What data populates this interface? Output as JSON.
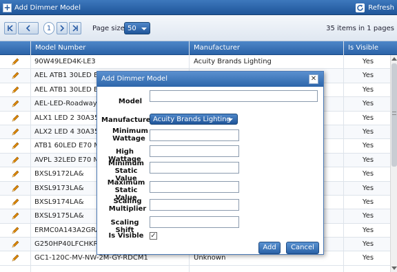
{
  "toolbar": {
    "add_label": "Add Dimmer Model",
    "refresh_label": "Refresh"
  },
  "pager": {
    "current_page": "1",
    "page_size_label": "Page size:",
    "page_size_value": "50",
    "items_info": "35 items in 1 pages"
  },
  "grid": {
    "columns": [
      "Model Number",
      "Manufacturer",
      "Is Visible"
    ],
    "rows": [
      {
        "model": "90W49LED4K-LE3",
        "manufacturer": "Acuity Brands Lighting",
        "visible": "Yes"
      },
      {
        "model": "AEL ATB1 30LED E53",
        "manufacturer": "",
        "visible": "Yes"
      },
      {
        "model": "AEL ATB1 30LED E70",
        "manufacturer": "",
        "visible": "Yes"
      },
      {
        "model": "AEL-LED-Roadway",
        "manufacturer": "",
        "visible": "Yes"
      },
      {
        "model": "ALX1 LED 2 30A350/",
        "manufacturer": "",
        "visible": "Yes"
      },
      {
        "model": "ALX2 LED 4 30A350/",
        "manufacturer": "",
        "visible": "Yes"
      },
      {
        "model": "ATB1 60LED E70 MVO",
        "manufacturer": "",
        "visible": "Yes"
      },
      {
        "model": "AVPL 32LED E70 MVO",
        "manufacturer": "",
        "visible": "Yes"
      },
      {
        "model": "BXSL9172LA&",
        "manufacturer": "",
        "visible": "Yes"
      },
      {
        "model": "BXSL9173LA&",
        "manufacturer": "",
        "visible": "Yes"
      },
      {
        "model": "BXSL9174LA&",
        "manufacturer": "",
        "visible": "Yes"
      },
      {
        "model": "BXSL9175LA&",
        "manufacturer": "",
        "visible": "Yes"
      },
      {
        "model": "ERMC0A143A2GRAY",
        "manufacturer": "",
        "visible": "Yes"
      },
      {
        "model": "G250HP40LFCHKR-D",
        "manufacturer": "",
        "visible": "Yes"
      },
      {
        "model": "GC1-120C-MV-NW-2M-GY-RDCM1",
        "manufacturer": "Unknown",
        "visible": "Yes"
      }
    ]
  },
  "dialog": {
    "title": "Add Dimmer Model",
    "model_label": "Model",
    "manufacturer_label": "Manufacturer",
    "manufacturer_value": "Acuity Brands Lighting",
    "min_wattage_label": "Minimum Wattage",
    "high_wattage_label": "High Wattage",
    "min_static_label": "Minimum Static Value",
    "max_static_label": "Maximum Static Value",
    "scaling_multiplier_label": "Scaling Multiplier",
    "scaling_shift_label": "Scaling Shift",
    "is_visible_label": "Is Visible",
    "is_visible_checked": "✓",
    "add_button": "Add",
    "cancel_button": "Cancel"
  },
  "colors": {
    "header_blue": "#2b63a8",
    "edit_pencil": "#e08a00"
  }
}
